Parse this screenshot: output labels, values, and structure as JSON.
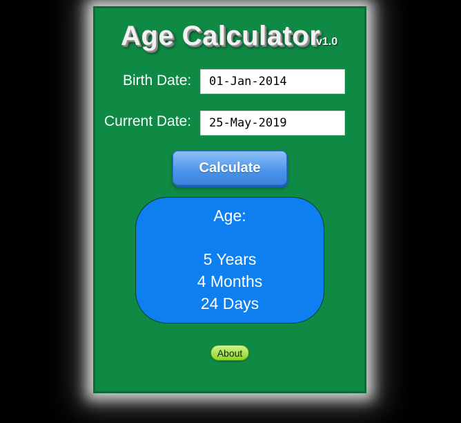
{
  "app": {
    "title": "Age Calculator",
    "version": "v1.0"
  },
  "form": {
    "birth_label": "Birth Date:",
    "birth_value": "01-Jan-2014",
    "current_label": "Current Date:",
    "current_value": "25-May-2019",
    "calculate_label": "Calculate"
  },
  "result": {
    "heading": "Age:",
    "years": "5 Years",
    "months": "4 Months",
    "days": "24 Days"
  },
  "footer": {
    "about_label": "About"
  },
  "colors": {
    "panel": "#0f8a45",
    "result_bg": "#0e7ff0",
    "button": "#4a93ea",
    "about_button": "#a8e04a"
  }
}
